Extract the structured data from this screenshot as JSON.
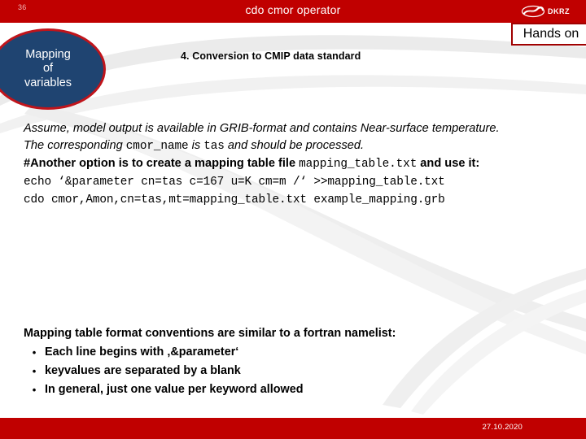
{
  "header": {
    "slide_number": "36",
    "title": "cdo cmor operator",
    "logo_word": "DKRZ",
    "logo_icon": "dkrz-globe-icon",
    "bar_color": "#c00000"
  },
  "hands_on": {
    "label": "Hands on",
    "border_color": "#a00000"
  },
  "badge": {
    "line1": "Mapping",
    "line2": "of",
    "line3": "variables",
    "fill_color": "#1f4471",
    "border_color": "#c0141b"
  },
  "section": {
    "heading": "4. Conversion to CMIP data standard"
  },
  "body": {
    "line1": "Assume, model output is available in GRIB-format and contains Near-surface temperature.",
    "line2_a": "The corresponding ",
    "line2_mono1": "cmor_name",
    "line2_b": " is ",
    "line2_mono2": "tas",
    "line2_c": " and should be processed.",
    "line3_a": "#Another option is to create a mapping table file ",
    "line3_mono": "mapping_table.txt",
    "line3_b": " and use it:",
    "code1": "echo ‘&parameter cn=tas c=167 u=K cm=m /‘ >>mapping_table.txt",
    "code2": "cdo cmor,Amon,cn=tas,mt=mapping_table.txt example_mapping.grb"
  },
  "lower": {
    "title": "Mapping table format conventions are similar to a fortran namelist:",
    "bullet_glyph": "•",
    "bullets": [
      "Each line begins with ‚&parameter‘",
      "keyvalues are separated by a blank",
      "In general, just one value per keyword allowed"
    ]
  },
  "footer": {
    "date": "27.10.2020",
    "bar_color": "#c00000"
  }
}
